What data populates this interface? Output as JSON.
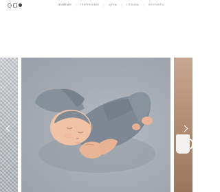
{
  "header": {
    "social": [
      {
        "icon": "vk-icon",
        "glyph": ""
      },
      {
        "icon": "instagram-icon",
        "glyph": ""
      },
      {
        "icon": "facebook-icon",
        "glyph": ""
      }
    ],
    "nav": [
      {
        "label": "ГЛАВНАЯ",
        "active": true
      },
      {
        "label": "ПОРТФОЛИО",
        "active": false
      },
      {
        "label": "ЦЕНЫ",
        "active": false
      },
      {
        "label": "ОТЗЫВЫ",
        "active": false
      },
      {
        "label": "КОНТАКТЫ",
        "active": false
      }
    ]
  },
  "gallery": {
    "slides": [
      "knit-blanket",
      "sleeping-newborn",
      "coffee-mug"
    ],
    "colors": {
      "backdrop": "#a8adb5",
      "outfit": "#7d8894",
      "skin": "#f0c2a6"
    }
  }
}
